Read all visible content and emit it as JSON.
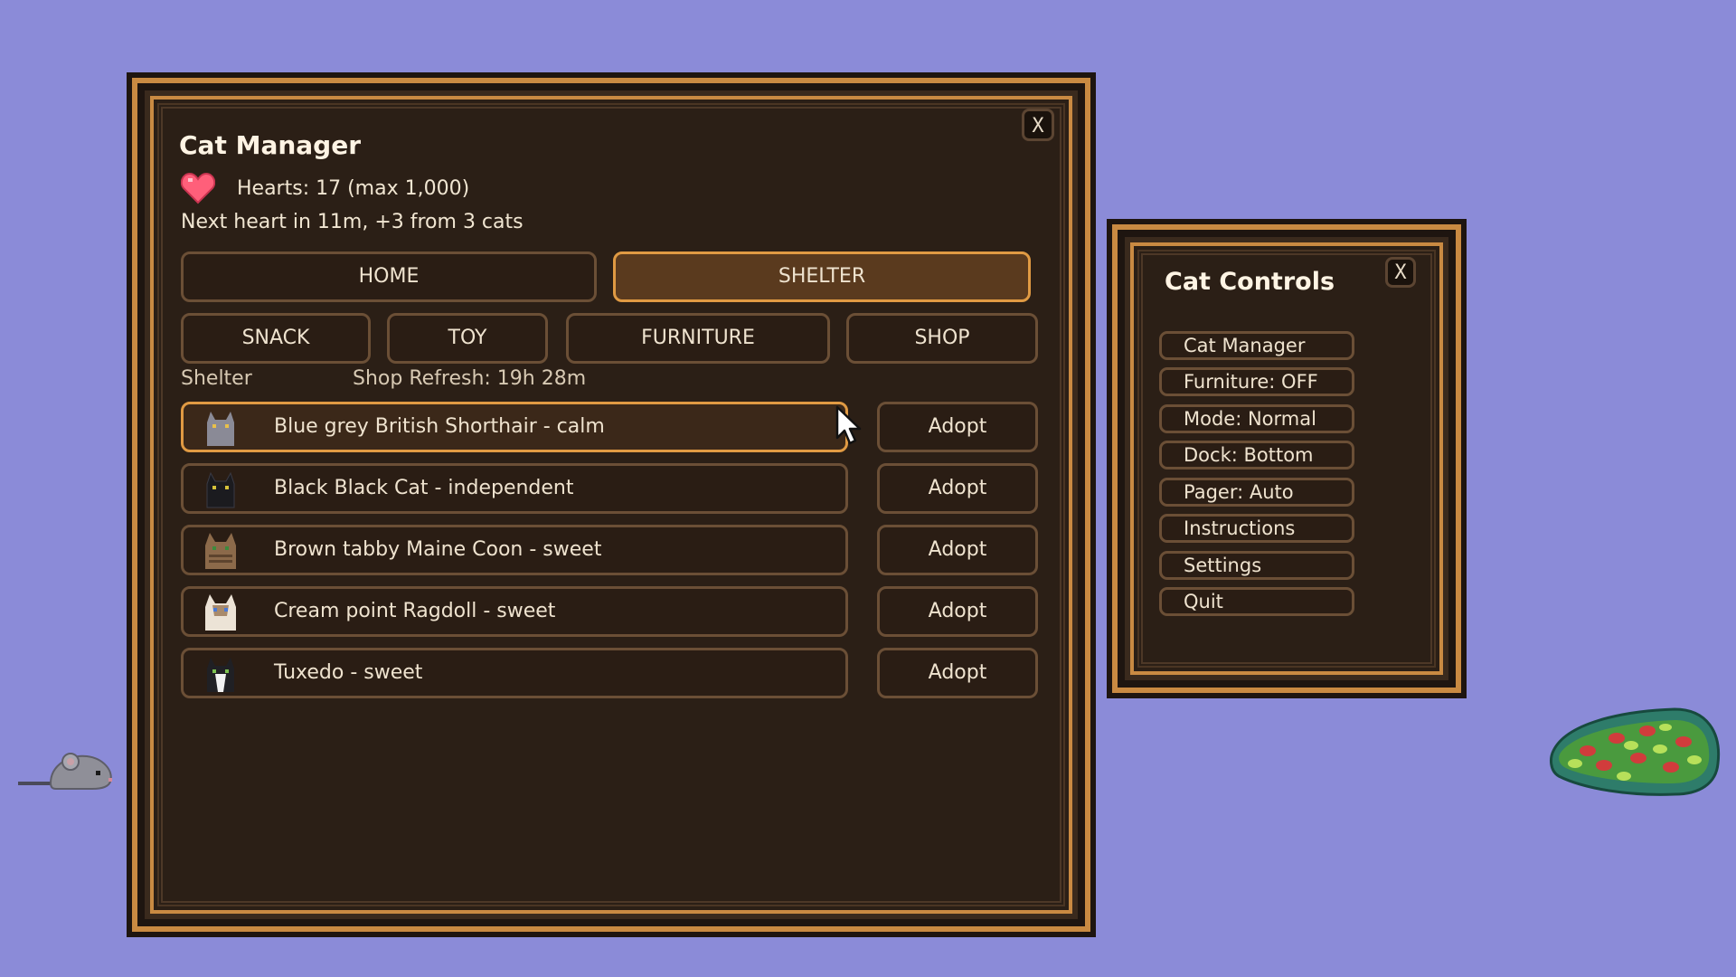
{
  "manager": {
    "title": "Cat Manager",
    "close": "X",
    "hearts": "Hearts: 17 (max 1,000)",
    "next_heart": "Next heart in 11m, +3 from 3 cats",
    "tabs": [
      "HOME",
      "SHELTER"
    ],
    "active_tab": "SHELTER",
    "subtabs": [
      "SNACK",
      "TOY",
      "FURNITURE",
      "SHOP"
    ],
    "section_label": "Shelter",
    "shop_refresh": "Shop Refresh: 19h 28m",
    "adopt_label": "Adopt",
    "cats": [
      {
        "label": "Blue grey British Shorthair - calm",
        "color": "#8a8a96"
      },
      {
        "label": "Black Black Cat - independent",
        "color": "#1b1b1f"
      },
      {
        "label": "Brown tabby Maine Coon - sweet",
        "color": "#8c6a4a"
      },
      {
        "label": "Cream point Ragdoll - sweet",
        "color": "#ece3d6"
      },
      {
        "label": "Tuxedo - sweet",
        "color": "#202024"
      }
    ]
  },
  "controls": {
    "title": "Cat Controls",
    "close": "X",
    "items": [
      "Cat Manager",
      "Furniture: OFF",
      "Mode: Normal",
      "Dock: Bottom",
      "Pager: Auto",
      "Instructions",
      "Settings",
      "Quit"
    ]
  },
  "colors": {
    "background": "#8b8bd8",
    "panel": "#2b1f16",
    "accent": "#e09a43",
    "heart": "#ff5f7a"
  }
}
